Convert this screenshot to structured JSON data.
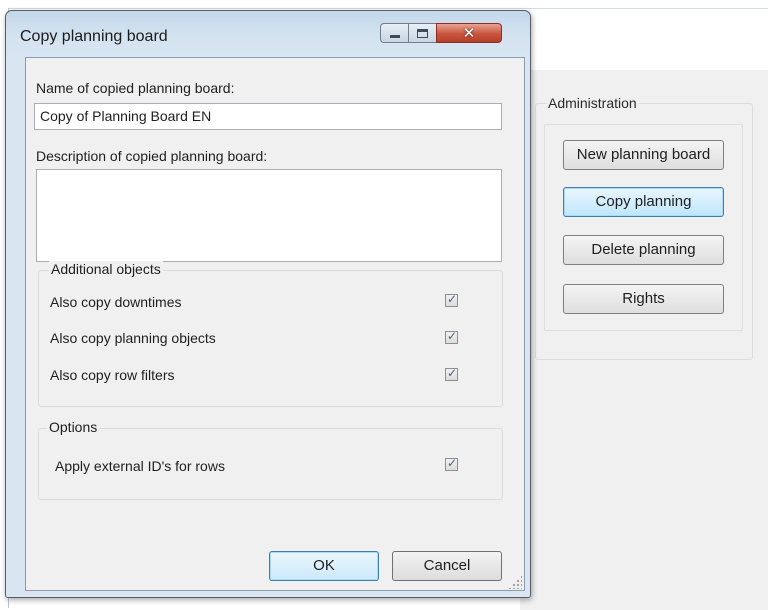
{
  "background_app": {
    "administration": {
      "legend": "Administration",
      "buttons": [
        "New planning board",
        "Copy planning",
        "Delete planning",
        "Rights"
      ]
    }
  },
  "dialog": {
    "title": "Copy planning board",
    "window_buttons": {
      "minimize": "minimize-icon",
      "maximize": "maximize-icon",
      "close": "close-icon"
    },
    "name_label": "Name of copied planning board:",
    "name_value": "Copy of Planning Board EN",
    "description_label": "Description of copied planning board:",
    "description_value": "",
    "additional_objects": {
      "legend": "Additional objects",
      "items": [
        {
          "label": "Also copy downtimes",
          "checked": true
        },
        {
          "label": "Also copy planning objects",
          "checked": true
        },
        {
          "label": "Also copy row filters",
          "checked": true
        }
      ]
    },
    "options": {
      "legend": "Options",
      "items": [
        {
          "label": "Apply external ID's for rows",
          "checked": true
        }
      ]
    },
    "ok_label": "OK",
    "cancel_label": "Cancel"
  },
  "colors": {
    "title_bar": "#c4d8ea",
    "client_background": "#f0f0f0",
    "close_button": "#c8553e",
    "focus_accent": "#3c7fb1"
  }
}
